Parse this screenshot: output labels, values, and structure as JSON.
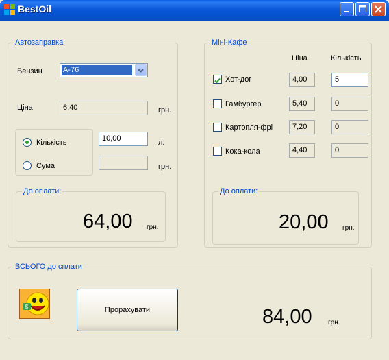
{
  "window": {
    "title": "BestOil"
  },
  "fuel": {
    "legend": "Автозаправка",
    "fuel_label": "Бензин",
    "fuel_selected": "А-76",
    "price_label": "Ціна",
    "price_value": "6,40",
    "price_unit": "грн.",
    "qty_option": "Кількість",
    "qty_value": "10,00",
    "qty_unit": "л.",
    "sum_option": "Сума",
    "sum_value": "",
    "sum_unit": "грн.",
    "pay_legend": "До оплати:",
    "pay_amount": "64,00",
    "pay_unit": "грн.",
    "selected_mode": "Кількість"
  },
  "cafe": {
    "legend": "Міні-Кафе",
    "col_price": "Ціна",
    "col_qty": "Кількість",
    "items": [
      {
        "name": "Хот-дог",
        "price": "4,00",
        "qty": "5",
        "checked": true
      },
      {
        "name": "Гамбургер",
        "price": "5,40",
        "qty": "0",
        "checked": false
      },
      {
        "name": "Картопля-фрі",
        "price": "7,20",
        "qty": "0",
        "checked": false
      },
      {
        "name": "Кока-кола",
        "price": "4,40",
        "qty": "0",
        "checked": false
      }
    ],
    "pay_legend": "До оплати:",
    "pay_amount": "20,00",
    "pay_unit": "грн."
  },
  "total": {
    "legend": "ВСЬОГО до сплати",
    "button_label": "Прорахувати",
    "amount": "84,00",
    "unit": "грн."
  }
}
